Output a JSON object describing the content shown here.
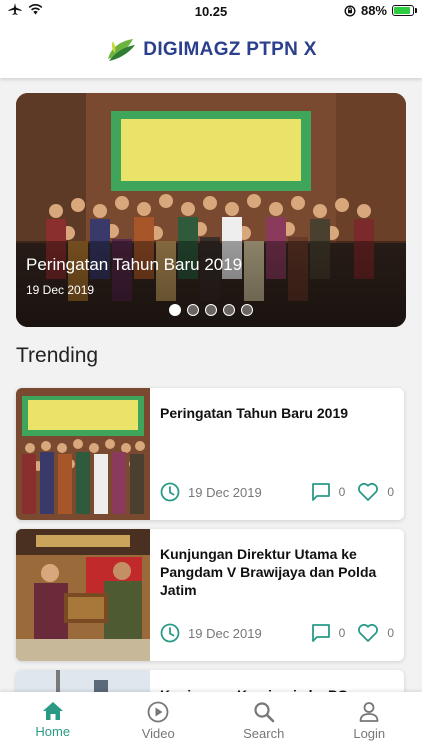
{
  "status": {
    "time": "10.25",
    "battery": "88%"
  },
  "header": {
    "brand": "DIGIMAGZ PTPN X"
  },
  "carousel": {
    "title": "Peringatan Tahun Baru 2019",
    "date": "19 Dec 2019",
    "dots": 5,
    "active_index": 0
  },
  "section": {
    "trending": "Trending"
  },
  "articles": [
    {
      "title": "Peringatan Tahun Baru 2019",
      "date": "19 Dec 2019",
      "comments": "0",
      "likes": "0"
    },
    {
      "title": "Kunjungan Direktur Utama ke Pangdam V Brawijaya dan Polda Jatim",
      "date": "19 Dec 2019",
      "comments": "0",
      "likes": "0"
    },
    {
      "title": "Kunjungan Komisaris ke PG"
    }
  ],
  "nav": [
    {
      "label": "Home",
      "icon": "home-icon",
      "active": true
    },
    {
      "label": "Video",
      "icon": "play-circle-icon",
      "active": false
    },
    {
      "label": "Search",
      "icon": "search-icon",
      "active": false
    },
    {
      "label": "Login",
      "icon": "person-icon",
      "active": false
    }
  ],
  "colors": {
    "accent": "#2a9a86",
    "brand": "#2b3f8c",
    "battery": "#2ecc40"
  }
}
